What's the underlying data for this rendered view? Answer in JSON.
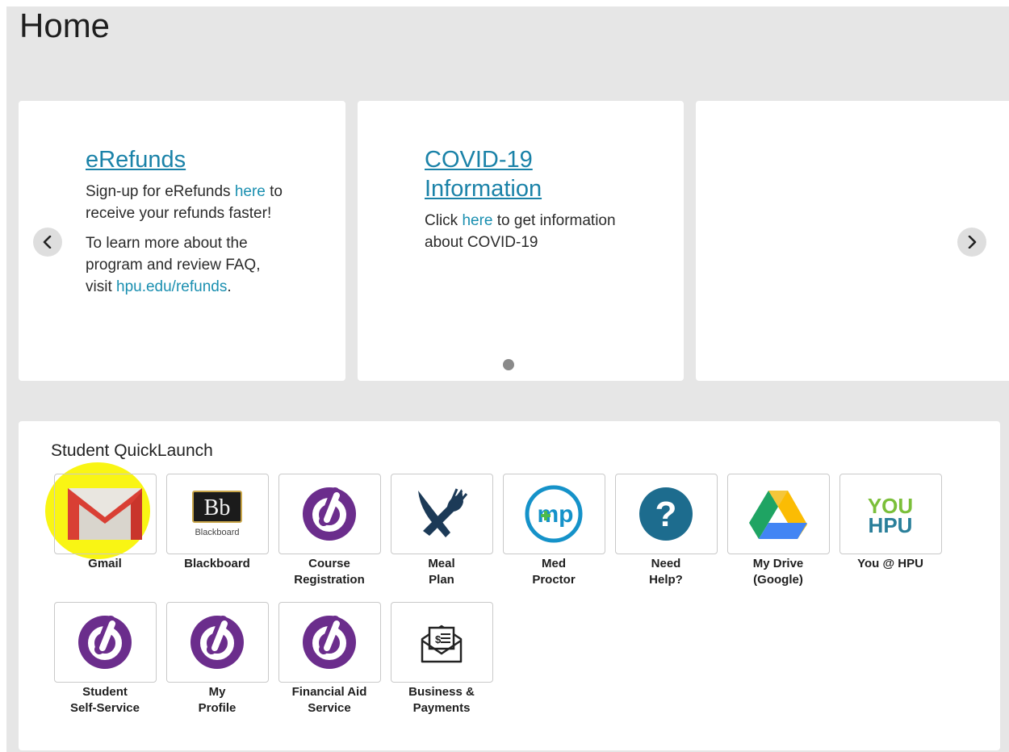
{
  "page": {
    "title": "Home"
  },
  "carousel": {
    "cards": [
      {
        "title": "eRefunds",
        "p1_before": "Sign-up for eRefunds ",
        "p1_link": "here",
        "p1_after": " to receive your refunds faster!",
        "p2_before": "To learn more about the program and review FAQ, visit ",
        "p2_link": "hpu.edu/refunds",
        "p2_after": "."
      },
      {
        "title": "COVID-19 Information",
        "p1_before": "Click ",
        "p1_link": "here",
        "p1_after": " to get information about COVID-19"
      }
    ]
  },
  "quicklaunch": {
    "title": "Student QuickLaunch",
    "tiles": [
      {
        "label": "Gmail",
        "icon": "gmail-icon"
      },
      {
        "label": "Blackboard",
        "icon": "blackboard-icon",
        "icon_text": "Bb",
        "icon_subtext": "Blackboard"
      },
      {
        "label": "Course\nRegistration",
        "icon": "ellucian-icon"
      },
      {
        "label": "Meal\nPlan",
        "icon": "knife-fork-icon"
      },
      {
        "label": "Med\nProctor",
        "icon": "medproctor-icon",
        "icon_text": "mp"
      },
      {
        "label": "Need\nHelp?",
        "icon": "question-icon",
        "icon_text": "?"
      },
      {
        "label": "My Drive\n(Google)",
        "icon": "google-drive-icon"
      },
      {
        "label": "You @ HPU",
        "icon": "you-hpu-icon",
        "icon_text_top": "YOU",
        "icon_text_bottom": "HPU"
      },
      {
        "label": "Student\nSelf-Service",
        "icon": "ellucian-icon"
      },
      {
        "label": "My\nProfile",
        "icon": "ellucian-icon"
      },
      {
        "label": "Financial Aid\nService",
        "icon": "ellucian-icon"
      },
      {
        "label": "Business &\nPayments",
        "icon": "envelope-bill-icon"
      }
    ]
  },
  "colors": {
    "link": "#1a82a8",
    "ellucian_purple": "#6b2d8c",
    "help_blue": "#1d6c8e",
    "highlight": "#f8f400"
  }
}
